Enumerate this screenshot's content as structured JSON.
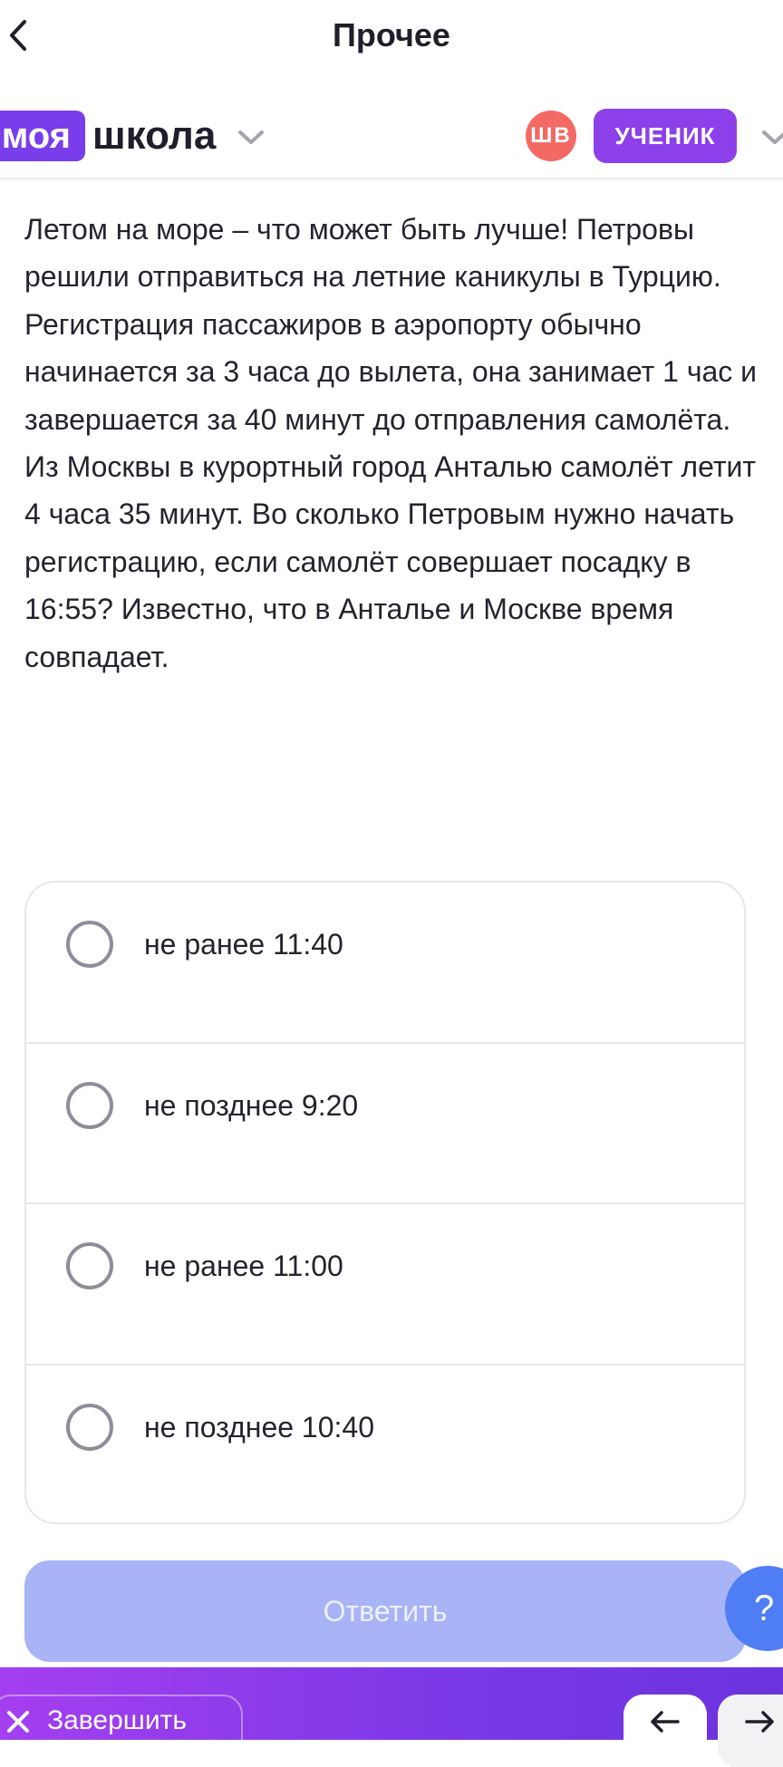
{
  "header": {
    "title": "Прочее",
    "back_icon": "chevron-left-icon"
  },
  "brand": {
    "part1": "моя",
    "part2": "школа",
    "part1_color": "#7a3dec"
  },
  "user": {
    "initials": "ШВ",
    "avatar_color": "#f36a64",
    "role": "УЧЕНИК",
    "role_color": "#8c40e9"
  },
  "question": {
    "text": "Летом на море – что может быть лучше! Петровы решили отправиться на летние каникулы в Турцию. Регистрация пассажиров в аэропорту обычно начинается за 3 часа до вылета, она занимает 1 час и завершается за 40 минут до отправления самолёта. Из Москвы в курортный город Анталью самолёт летит 4 часа 35 минут. Во сколько Петровым нужно начать регистрацию, если самолёт совершает посадку в 16:55? Известно, что в Анталье и Москве время совпадает."
  },
  "options": [
    {
      "label": "не ранее 11:40",
      "selected": false
    },
    {
      "label": "не позднее 9:20",
      "selected": false
    },
    {
      "label": "не ранее 11:00",
      "selected": false
    },
    {
      "label": "не позднее 10:40",
      "selected": false
    }
  ],
  "actions": {
    "submit_label": "Ответить",
    "submit_color": "#a8b4f6",
    "help_label": "?",
    "finish_label": "Завершить",
    "prev_icon": "arrow-left-icon",
    "next_icon": "arrow-right-icon"
  }
}
